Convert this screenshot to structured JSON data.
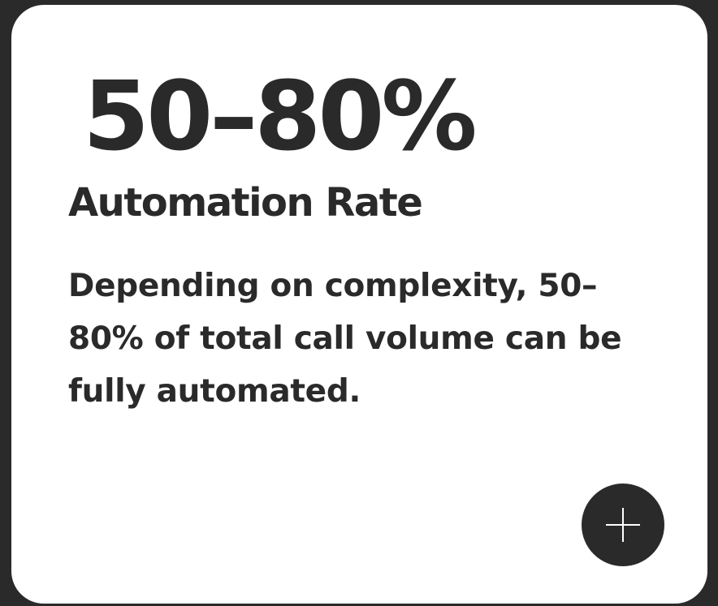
{
  "card": {
    "stat": "50–80%",
    "label": "Automation Rate",
    "description": "Depending on complexity, 50–80% of total call volume can be fully automated.",
    "expand_icon": "plus-icon"
  },
  "colors": {
    "background": "#2a2a2a",
    "card": "#ffffff",
    "text": "#2a2a2a",
    "button": "#2a2a2a",
    "icon": "#ffffff"
  }
}
